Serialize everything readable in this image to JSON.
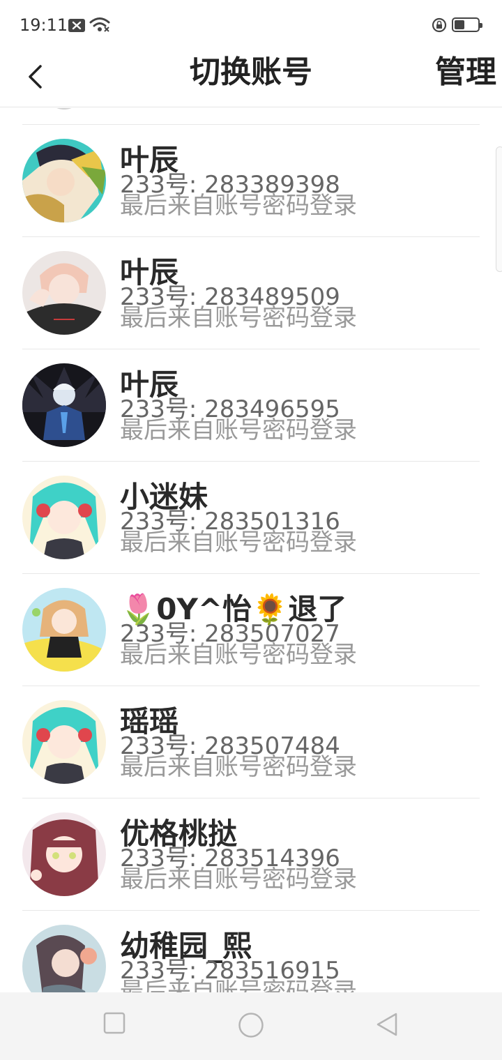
{
  "status_bar": {
    "time": "19:11",
    "icons": [
      "notification-x-icon",
      "wifi-icon",
      "rotation-lock-icon",
      "battery-icon"
    ]
  },
  "header": {
    "back_icon": "chevron-left-icon",
    "title": "切换账号",
    "manage_label": "管理"
  },
  "accounts": [
    {
      "name": "叶辰",
      "id": "233号: 283389398",
      "login": "最后来自账号密码登录"
    },
    {
      "name": "叶辰",
      "id": "233号: 283489509",
      "login": "最后来自账号密码登录"
    },
    {
      "name": "叶辰",
      "id": "233号: 283496595",
      "login": "最后来自账号密码登录"
    },
    {
      "name": "小迷妹",
      "id": "233号: 283501316",
      "login": "最后来自账号密码登录"
    },
    {
      "name": "🌷0Y^怡🌻退了",
      "id": "233号: 283507027",
      "login": "最后来自账号密码登录"
    },
    {
      "name": "瑶瑶",
      "id": "233号: 283507484",
      "login": "最后来自账号密码登录"
    },
    {
      "name": "优格桃挞",
      "id": "233号: 283514396",
      "login": "最后来自账号密码登录"
    },
    {
      "name": "幼稚园_熙",
      "id": "233号: 283516915",
      "login": "最后来自账号密码登录"
    }
  ],
  "nav_bar": {
    "icons": [
      "recents-square-icon",
      "home-circle-icon",
      "back-triangle-icon"
    ]
  },
  "colors": {
    "background": "#ffffff",
    "title_text": "#222222",
    "id_text": "#666666",
    "login_text": "#999999",
    "divider": "#e8e8e8",
    "nav_bar_bg": "#f4f4f4"
  }
}
